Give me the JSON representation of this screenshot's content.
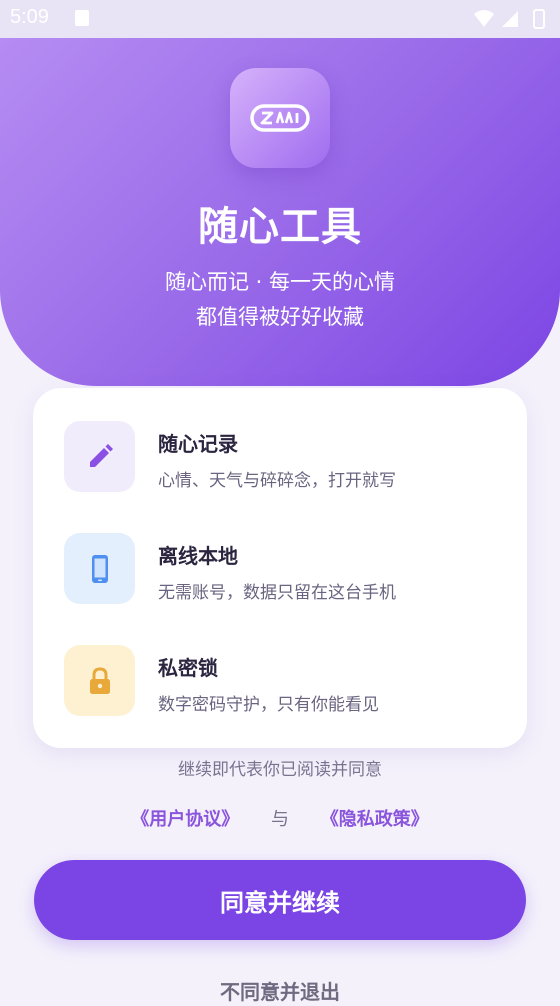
{
  "status_bar": {
    "time": "5:09",
    "icons": [
      "photo-icon",
      "wifi-icon",
      "signal-icon",
      "battery-icon"
    ]
  },
  "header": {
    "app_icon": "app-logo-icon",
    "title": "随心工具",
    "tagline_line1": "随心而记 · 每一天的心情",
    "tagline_line2": "都值得被好好收藏",
    "colors": {
      "gradient_start": "#b58cf2",
      "gradient_end": "#7c45e4"
    }
  },
  "features": [
    {
      "icon": "pencil-icon",
      "title": "随心记录",
      "description": "心情、天气与碎碎念，打开就写",
      "icon_bg": "#f1ecfb",
      "icon_color": "#8a4fe3"
    },
    {
      "icon": "phone-icon",
      "title": "离线本地",
      "description": "无需账号，数据只留在这台手机",
      "icon_bg": "#e3effd",
      "icon_color": "#4f8ff0"
    },
    {
      "icon": "lock-icon",
      "title": "私密锁",
      "description": "数字密码守护，只有你能看见",
      "icon_bg": "#fdf1d2",
      "icon_color": "#e8a93a"
    }
  ],
  "agreement": {
    "text": "继续即代表你已阅读并同意",
    "user_agreement": "《用户协议》",
    "separator": "与",
    "privacy_policy": "《隐私政策》"
  },
  "actions": {
    "agree_label": "同意并继续",
    "disagree_label": "不同意并退出"
  },
  "colors": {
    "accent": "#7b45e6",
    "link": "#8a55dc"
  }
}
